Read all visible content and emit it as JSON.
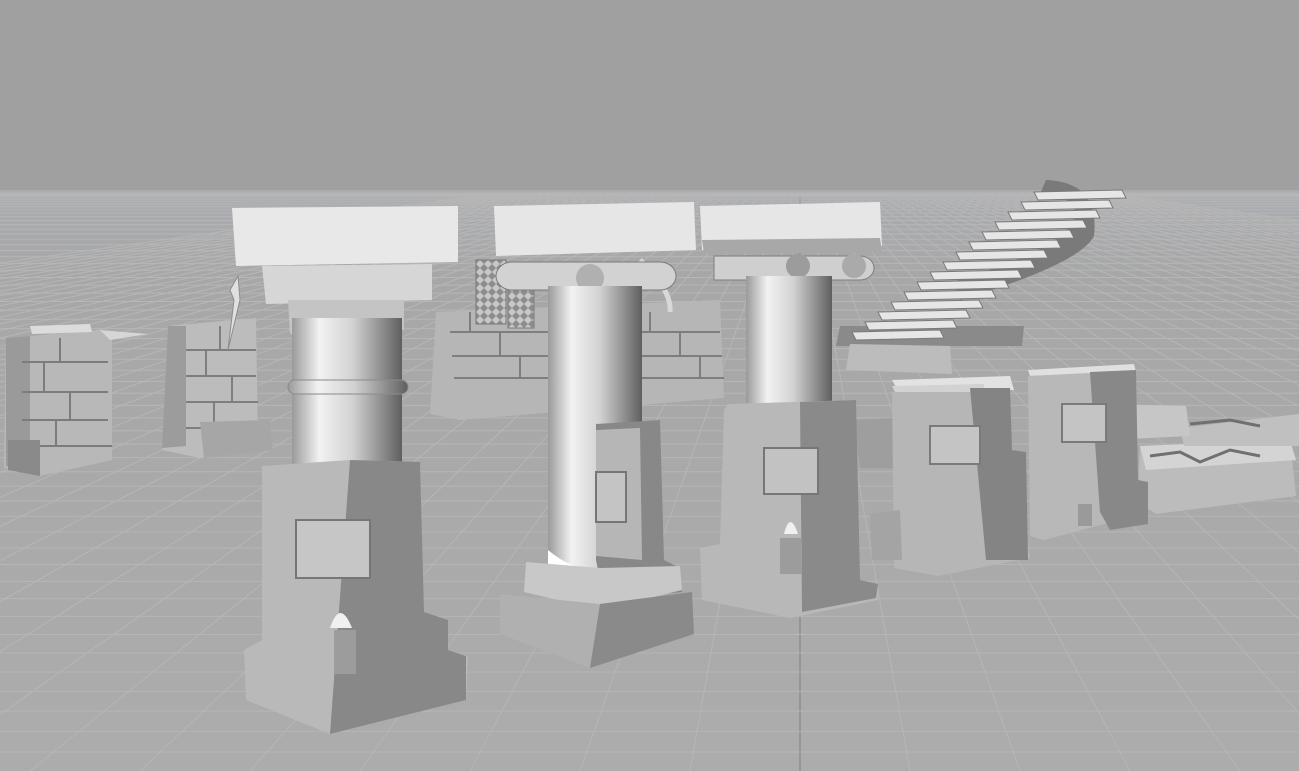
{
  "viewport": {
    "kind": "3d-perspective-viewport",
    "render_mode": "grayscale-shaded",
    "colors": {
      "background": "#a0a0a0",
      "floor": "#aaaaaa",
      "grid_line": "#b6b6b6",
      "grid_major": "#8c8c8c",
      "model_light": "#e4e4e4",
      "model_mid": "#b4b4b4",
      "model_dark": "#7a7a7a"
    }
  },
  "scene_objects": [
    {
      "name": "broken-wall-fragment-left",
      "type": "model"
    },
    {
      "name": "broken-wall-fragment-small",
      "type": "model"
    },
    {
      "name": "ruined-pillar-banded-shaft",
      "type": "model"
    },
    {
      "name": "ruined-pillar-ionic-tall",
      "type": "model"
    },
    {
      "name": "ruined-pillar-ionic-short",
      "type": "model"
    },
    {
      "name": "carved-wall-with-lattice-panels",
      "type": "model"
    },
    {
      "name": "spiral-staircase",
      "type": "model"
    },
    {
      "name": "broken-pillar-base-right-a",
      "type": "model"
    },
    {
      "name": "broken-pillar-base-right-b",
      "type": "model"
    },
    {
      "name": "carved-floor-slabs",
      "type": "model"
    }
  ]
}
